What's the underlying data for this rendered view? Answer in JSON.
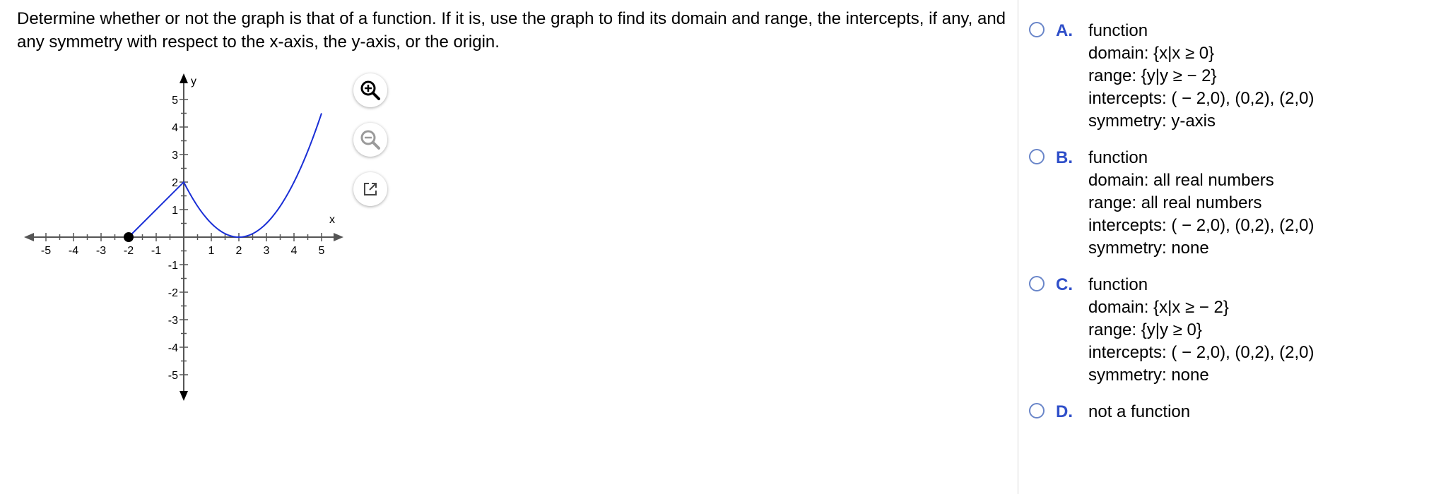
{
  "question": {
    "text": "Determine whether or not the graph is that of a function. If it is, use the graph to find its domain and range, the intercepts, if any, and any symmetry with respect to the x-axis, the y-axis, or the origin."
  },
  "graph": {
    "x_axis_label": "x",
    "y_axis_label": "y",
    "x_ticks": [
      "-5",
      "-4",
      "-3",
      "-2",
      "-1",
      "1",
      "2",
      "3",
      "4",
      "5"
    ],
    "y_ticks": [
      "5",
      "4",
      "3",
      "2",
      "1",
      "-1",
      "-2",
      "-3",
      "-4",
      "-5"
    ],
    "xlim": [
      -5,
      5
    ],
    "ylim": [
      -5,
      5
    ],
    "curve_color": "#1a2fd6",
    "closed_point": {
      "x": -2,
      "y": 0
    },
    "segments": [
      {
        "type": "line",
        "from": {
          "x": -2,
          "y": 0
        },
        "to": {
          "x": 0,
          "y": 2
        }
      },
      {
        "type": "parabola",
        "formula": "0.5*(x-2)^2",
        "x_from": 0,
        "x_to": 5
      }
    ]
  },
  "tools": {
    "zoom_in_icon": "zoom-in-icon",
    "zoom_out_icon": "zoom-out-icon",
    "popout_icon": "external-link-icon"
  },
  "options": [
    {
      "letter": "A.",
      "lines": [
        "function",
        "domain: {x|x ≥ 0}",
        "range: {y|y ≥ − 2}",
        "intercepts: ( − 2,0), (0,2), (2,0)",
        "symmetry: y-axis"
      ]
    },
    {
      "letter": "B.",
      "lines": [
        "function",
        "domain: all real numbers",
        "range: all real numbers",
        "intercepts: ( − 2,0), (0,2), (2,0)",
        "symmetry: none"
      ]
    },
    {
      "letter": "C.",
      "lines": [
        "function",
        "domain: {x|x ≥ − 2}",
        "range: {y|y ≥ 0}",
        "intercepts: ( − 2,0), (0,2), (2,0)",
        "symmetry: none"
      ]
    },
    {
      "letter": "D.",
      "lines": [
        "not a function"
      ]
    }
  ],
  "colors": {
    "accent": "#2f4fc9",
    "radio_border": "#6a86c9"
  }
}
